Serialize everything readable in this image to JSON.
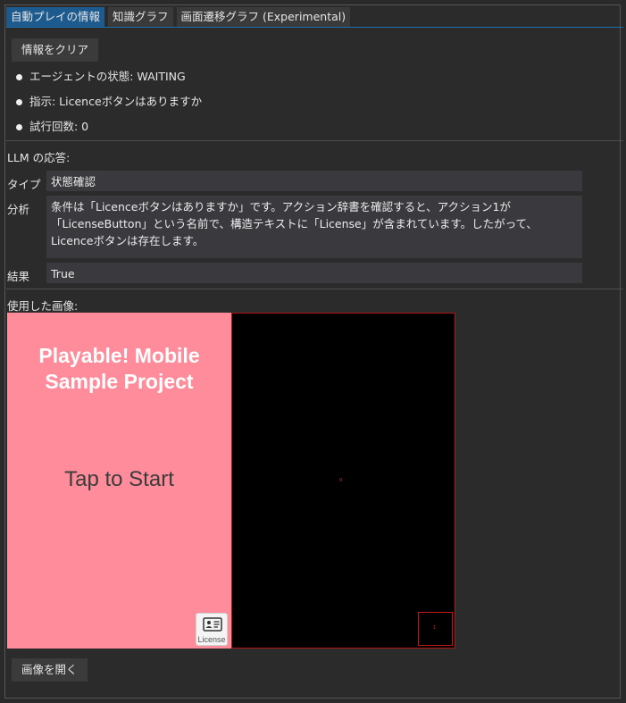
{
  "tabs": [
    {
      "label": "自動プレイの情報",
      "active": true
    },
    {
      "label": "知識グラフ",
      "active": false
    },
    {
      "label": "画面遷移グラフ (Experimental)",
      "active": false
    }
  ],
  "clear_button": "情報をクリア",
  "status": [
    "エージェントの状態: WAITING",
    "指示: Licenceボタンはありますか",
    "試行回数: 0"
  ],
  "llm": {
    "heading": "LLM の応答:",
    "type_label": "タイプ",
    "type_value": "状態確認",
    "analysis_label": "分析",
    "analysis_line1": "条件は「Licenceボタンはありますか」です。アクション辞書を確認すると、アクション1が",
    "analysis_line2": "「LicenseButton」という名前で、構造テキストに「License」が含まれています。したがって、",
    "analysis_line3": "Licenceボタンは存在します。",
    "result_label": "結果",
    "result_value": "True"
  },
  "images": {
    "heading": "使用した画像:",
    "screenshot": {
      "title_line1": "Playable! Mobile",
      "title_line2": "Sample Project",
      "tap_text": "Tap to Start",
      "license_label": "License",
      "bg_color": "#ff8c9b"
    },
    "annotated": {
      "index_0": "0",
      "index_1": "1",
      "box_color": "#c41818"
    }
  },
  "open_image_button": "画像を開く"
}
